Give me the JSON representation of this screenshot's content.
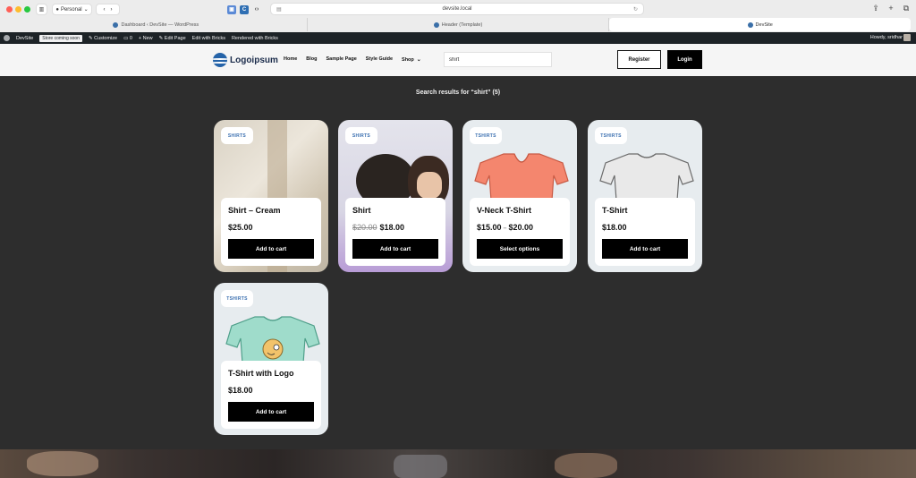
{
  "browser": {
    "profile": "Personal",
    "address": "devsite.local",
    "tabs": [
      {
        "label": "Dashboard ‹ DevSite — WordPress"
      },
      {
        "label": "Header (Template)"
      },
      {
        "label": "DevSite"
      }
    ]
  },
  "adminbar": {
    "site": "DevSite",
    "status": "Store coming soon",
    "customize": "Customize",
    "comments": "0",
    "new": "New",
    "edit_page": "Edit Page",
    "edit_bricks": "Edit with Bricks",
    "rendered": "Rendered with Bricks",
    "howdy": "Howdy, sridhar"
  },
  "header": {
    "logo": "Logoipsum",
    "nav": [
      "Home",
      "Blog",
      "Sample Page",
      "Style Guide",
      "Shop"
    ],
    "search_value": "shirt",
    "register": "Register",
    "login": "Login"
  },
  "results": {
    "title": "Search results for “shirt” (5)",
    "products": [
      {
        "category": "SHIRTS",
        "name": "Shirt – Cream",
        "price": "$25.00",
        "cta": "Add to cart"
      },
      {
        "category": "SHIRTS",
        "name": "Shirt",
        "old_price": "$20.00",
        "price": "$18.00",
        "cta": "Add to cart"
      },
      {
        "category": "TSHIRTS",
        "name": "V-Neck T-Shirt",
        "price_min": "$15.00",
        "price_sep": "–",
        "price_max": "$20.00",
        "cta": "Select options"
      },
      {
        "category": "TSHIRTS",
        "name": "T-Shirt",
        "price": "$18.00",
        "cta": "Add to cart"
      },
      {
        "category": "TSHIRTS",
        "name": "T-Shirt with Logo",
        "price": "$18.00",
        "cta": "Add to cart"
      }
    ]
  },
  "colors": {
    "accent": "#000000",
    "badge_text": "#3a6fb0",
    "page_bg": "#2d2d2d"
  }
}
